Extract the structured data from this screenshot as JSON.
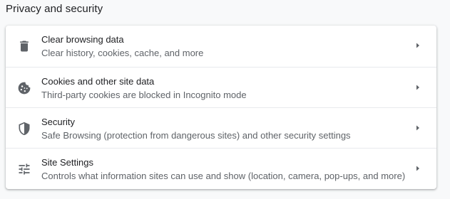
{
  "section": {
    "title": "Privacy and security"
  },
  "rows": [
    {
      "icon": "trash-icon",
      "label": "Clear browsing data",
      "sublabel": "Clear history, cookies, cache, and more"
    },
    {
      "icon": "cookie-icon",
      "label": "Cookies and other site data",
      "sublabel": "Third-party cookies are blocked in Incognito mode"
    },
    {
      "icon": "shield-icon",
      "label": "Security",
      "sublabel": "Safe Browsing (protection from dangerous sites) and other security settings"
    },
    {
      "icon": "tune-icon",
      "label": "Site Settings",
      "sublabel": "Controls what information sites can use and show (location, camera, pop-ups, and more)"
    }
  ],
  "colors": {
    "page_background": "#f8f9fa",
    "card_background": "#ffffff",
    "primary_text": "#202124",
    "secondary_text": "#5f6368",
    "icon": "#5f6368",
    "divider": "#e8eaed"
  }
}
